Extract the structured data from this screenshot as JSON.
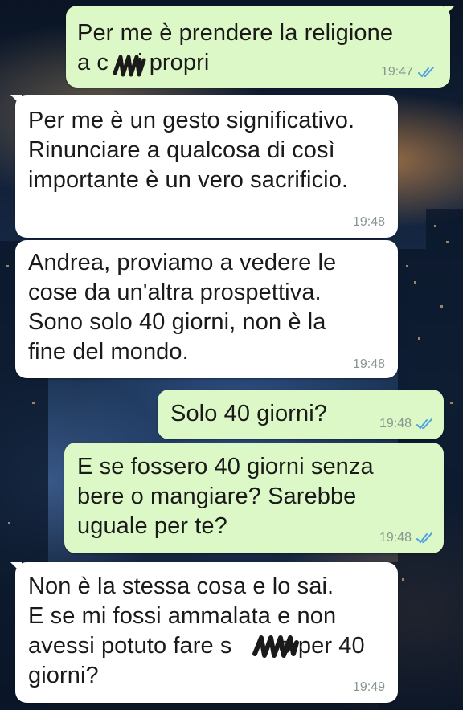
{
  "chat": {
    "messages": [
      {
        "direction": "outgoing",
        "text_line1": "Per me è prendere la religione",
        "text_line2a": "a c",
        "text_line2b": "i propri",
        "time": "19:47",
        "status": "read"
      },
      {
        "direction": "incoming",
        "text": "Per me è un gesto significativo.\nRinunciare a qualcosa di così\nimportante è un vero sacrificio.",
        "time": "19:48"
      },
      {
        "direction": "incoming",
        "text": "Andrea, proviamo a vedere le\ncose da un'altra prospettiva.\nSono solo 40 giorni, non è la\nfine del mondo.",
        "time": "19:48"
      },
      {
        "direction": "outgoing",
        "text": "Solo 40 giorni?",
        "time": "19:48",
        "status": "read"
      },
      {
        "direction": "outgoing",
        "text": "E se fossero 40 giorni senza\nbere o mangiare? Sarebbe\nuguale per te?",
        "time": "19:48",
        "status": "read"
      },
      {
        "direction": "incoming",
        "text_line1": "Non è la stessa cosa e lo sai.",
        "text_line2": "E se mi fossi ammalata e non",
        "text_line3a": "avessi potuto fare s",
        "text_line3b": "o per 40",
        "text_line4": "giorni?",
        "time": "19:49"
      }
    ]
  },
  "colors": {
    "outgoing_bubble": "#dcf8c6",
    "incoming_bubble": "#ffffff",
    "read_tick": "#4fa3e0",
    "timestamp": "#8a9590"
  },
  "icons": {
    "read_status": "double-check-icon",
    "redaction": "scribble-redaction"
  }
}
